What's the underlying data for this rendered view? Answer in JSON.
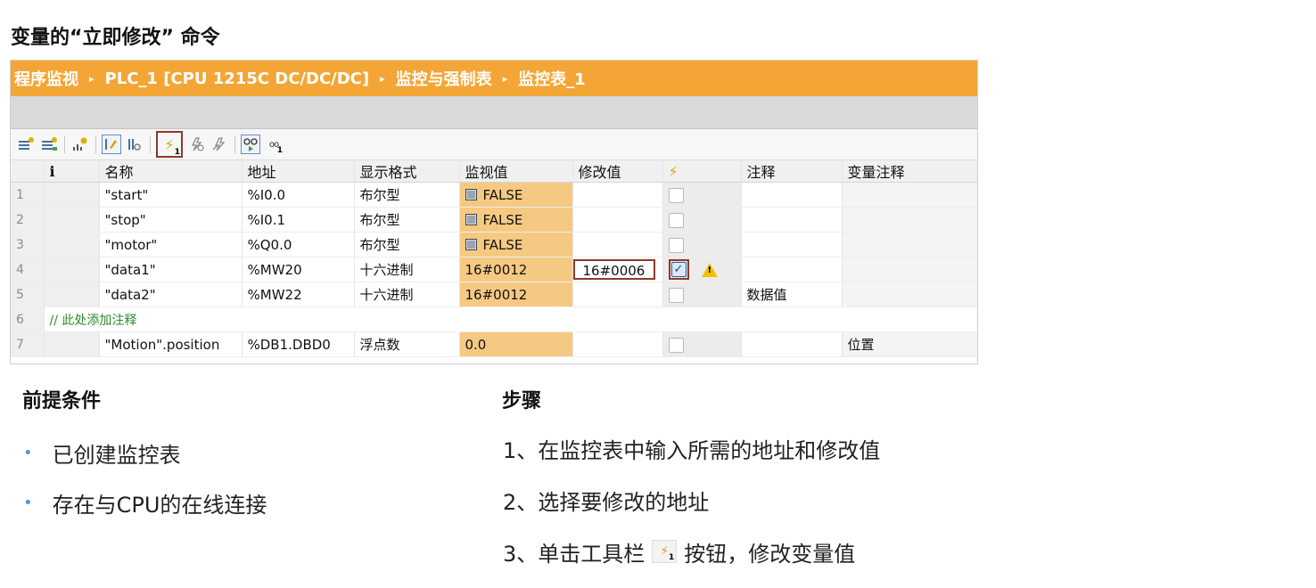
{
  "page_title": "变量的“立即修改” 命令",
  "breadcrumb": [
    "程序监视",
    "PLC_1 [CPU 1215C DC/DC/DC]",
    "监控与强制表",
    "监控表_1"
  ],
  "breadcrumb_separator": "▸",
  "toolbar_icons": [
    "insert-row-icon",
    "add-row-icon",
    "update-icon",
    "display-format-icon",
    "monitor-icon",
    "modify-now-icon",
    "modify-trigger-icon",
    "force-icon",
    "monitor-all-icon",
    "monitor-once-icon"
  ],
  "toolbar": {
    "bolt_glyph": "⚡",
    "bolt_sub": "1",
    "glasses_glyph": "oo",
    "glasses_sub": "1"
  },
  "table": {
    "headers": [
      "",
      "i",
      "名称",
      "地址",
      "显示格式",
      "监视值",
      "修改值",
      "⚡",
      "注释",
      "变量注释"
    ],
    "rows": [
      {
        "num": "1",
        "name": "\"start\"",
        "address": "%I0.0",
        "format": "布尔型",
        "monitor": "FALSE",
        "modify": "",
        "checked": false,
        "warning": false,
        "comment": "",
        "var_comment": ""
      },
      {
        "num": "2",
        "name": "\"stop\"",
        "address": "%I0.1",
        "format": "布尔型",
        "monitor": "FALSE",
        "modify": "",
        "checked": false,
        "warning": false,
        "comment": "",
        "var_comment": ""
      },
      {
        "num": "3",
        "name": "\"motor\"",
        "address": "%Q0.0",
        "format": "布尔型",
        "monitor": "FALSE",
        "modify": "",
        "checked": false,
        "warning": false,
        "comment": "",
        "var_comment": ""
      },
      {
        "num": "4",
        "name": "\"data1\"",
        "address": "%MW20",
        "format": "十六进制",
        "monitor": "16#0012",
        "modify": "16#0006",
        "checked": true,
        "warning": true,
        "comment": "",
        "var_comment": ""
      },
      {
        "num": "5",
        "name": "\"data2\"",
        "address": "%MW22",
        "format": "十六进制",
        "monitor": "16#0012",
        "modify": "",
        "checked": false,
        "warning": false,
        "comment": "数据值",
        "var_comment": ""
      },
      {
        "num": "6",
        "comment_line": "// 此处添加注释"
      },
      {
        "num": "7",
        "name": "\"Motion\".position",
        "address": "%DB1.DBD0",
        "format": "浮点数",
        "monitor": "0.0",
        "modify": "",
        "checked": false,
        "warning": false,
        "comment": "",
        "var_comment": "位置"
      }
    ],
    "check_glyph": "✓",
    "warning_glyph": "!"
  },
  "prereq": {
    "title": "前提条件",
    "items": [
      "已创建监控表",
      "存在与CPU的在线连接"
    ],
    "bullet": "•"
  },
  "steps": {
    "title": "步骤",
    "items": [
      "1、在监控表中输入所需的地址和修改值",
      "2、选择要修改的地址"
    ],
    "step3_before": "3、单击工具栏",
    "step3_after": "按钮，修改变量值"
  }
}
